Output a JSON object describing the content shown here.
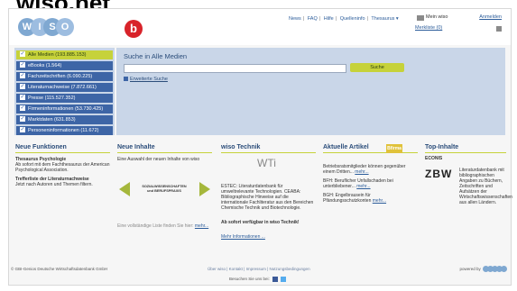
{
  "overlay_title": "wiso.net",
  "header": {
    "logo_letters": [
      "W",
      "I",
      "S",
      "O"
    ],
    "badge": "b",
    "nav": [
      "News",
      "FAQ",
      "Hilfe",
      "Quelleninfo",
      "Thesaurus ▾"
    ],
    "user": {
      "my_wiso": "Mein wiso",
      "login": "Anmelden",
      "watchlist": "Merkliste (0)"
    }
  },
  "menu": {
    "items": [
      "Alle Medien (193.885.153)",
      "eBooks (1.564)",
      "Fachzeitschriften (6.090.225)",
      "Literaturnachweise (7.872.661)",
      "Presse (115.527.352)",
      "Firmeninformationen (53.730.425)",
      "Marktdaten (631.853)",
      "Personeninformationen (11.672)"
    ]
  },
  "search": {
    "title": "Suche in Alle Medien",
    "value": "",
    "button": "Suche",
    "advanced": "Erweiterte Suche"
  },
  "news": {
    "title": "Neue Funktionen",
    "h1": "Thesaurus Psychologie",
    "p1": "Ab sofort mit dem Fachthesaurus der American Psychological Association.",
    "h2": "Trefferliste der Literaturnachweise",
    "p2": "Jetzt nach Autoren und Themen filtern."
  },
  "neue_inhalte": {
    "title": "Neue Inhalte",
    "intro": "Eine Auswahl der neuen Inhalte von wiso",
    "slide_line1": "SOZIALWISSENSCHAFTEN",
    "slide_line2": "und BERUFSPRAXIS",
    "more_text": "Eine vollständige Liste finden Sie hier:",
    "more_link": "mehr..."
  },
  "technik": {
    "title": "wiso Technik",
    "logo": "WTi",
    "text": "ESTEC: Literaturdatenbank für umweltrelevante Technologien. CEABA: Bibliographische Hinweise auf die internationale Fachliteratur aus den Bereichen Chemische Technik und Biotechnologie.",
    "bold": "Ab sofort verfügbar in wiso Technik!",
    "link": "Mehr Informationen ..."
  },
  "artikel": {
    "title": "Aktuelle Artikel",
    "badge": "Bfirma",
    "a1": "Betriebsratsmitglieder können gegenüber einem Dritten...",
    "a2": "BFH: Beruflicher Unfallschaden bei unterbliebener...",
    "a3": "BGH: Engelbrausein für Pfändungsschutzkonten",
    "link": "mehr..."
  },
  "top": {
    "title": "Top-Inhalte",
    "sub": "ECONIS",
    "logo": "ZBW",
    "text": "Literaturdatenbank mit bibliographischen Angaben zu Büchern, Zeitschriften und Aufsätzen der Wirtschaftswissenschaften aus allen Ländern."
  },
  "footer": {
    "copy": "© GBI-Genios Deutsche Wirtschaftsdatenbank GmbH",
    "links": "Über wiso | Kontakt | Impressum | Nutzungsbedingungen",
    "share": "Besuchen Sie uns bei:",
    "powered": "powered by"
  }
}
